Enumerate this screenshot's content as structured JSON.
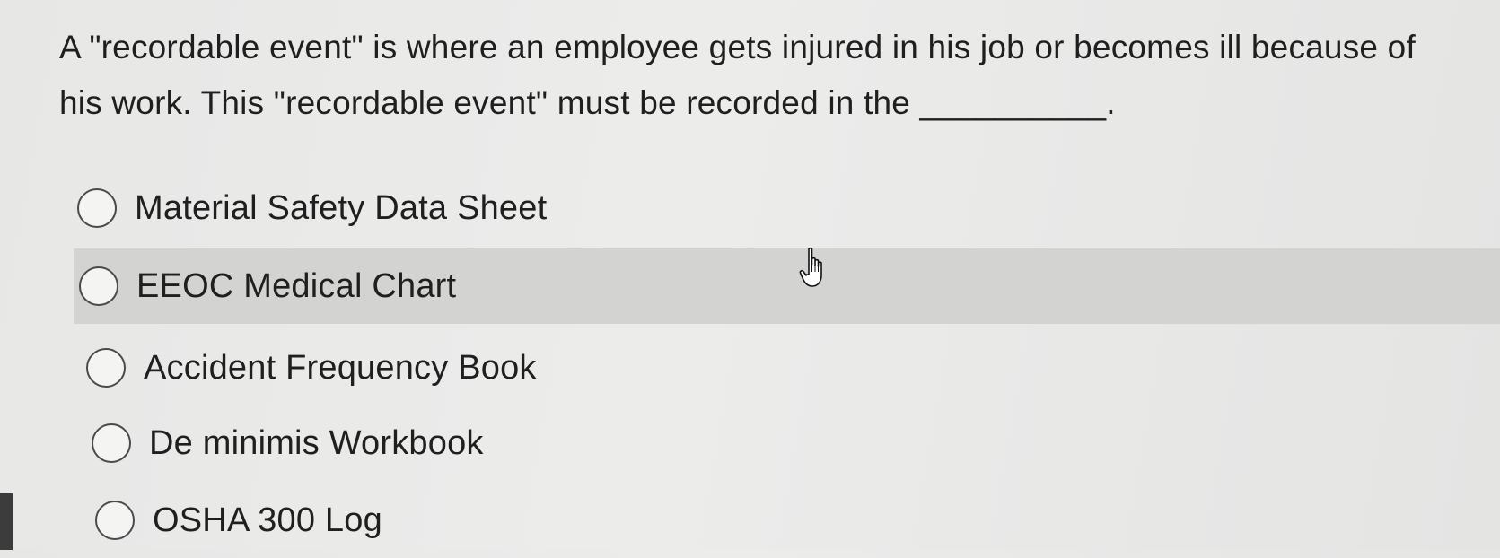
{
  "question": {
    "text": "A \"recordable event\" is where an employee gets injured in his job or becomes ill because of his work. This \"recordable event\" must be recorded in the __________."
  },
  "options": [
    {
      "label": "Material Safety Data Sheet",
      "selected": false
    },
    {
      "label": "EEOC Medical Chart",
      "selected": false,
      "hovered": true
    },
    {
      "label": "Accident Frequency Book",
      "selected": false
    },
    {
      "label": "De minimis Workbook",
      "selected": false
    },
    {
      "label": "OSHA 300 Log",
      "selected": false
    }
  ],
  "cursor": {
    "icon": "hand-pointer-icon"
  },
  "colors": {
    "background": "#e9e9e8",
    "hover_row": "#d3d3d2",
    "text": "#1f1f1f"
  }
}
